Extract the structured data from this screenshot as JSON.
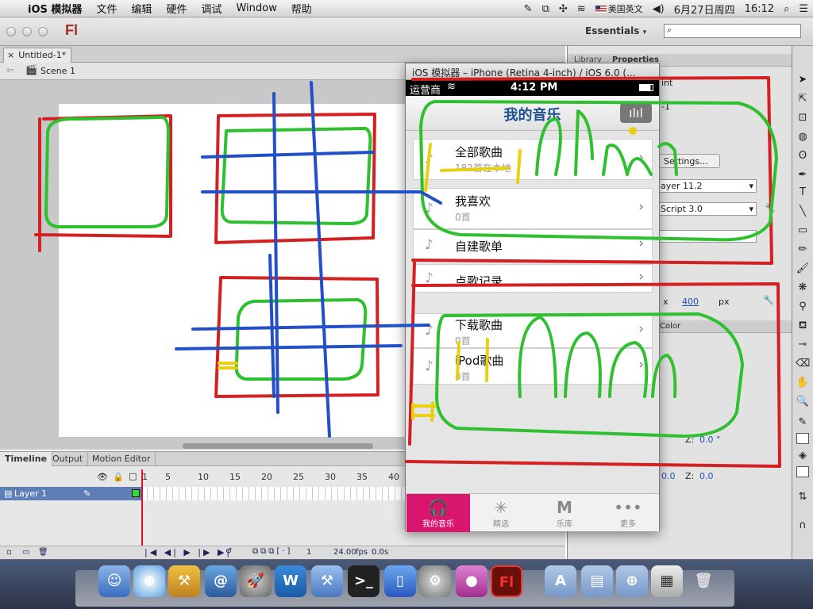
{
  "menubar": {
    "app": "iOS 模拟器",
    "items": [
      "文件",
      "编辑",
      "硬件",
      "调试",
      "Window",
      "帮助"
    ],
    "input_source": "美国英文",
    "date": "6月27日周四",
    "time": "16:12"
  },
  "flash": {
    "logo": "Fl",
    "workspace": "Essentials",
    "doc_tab": "Untitled-1*",
    "scene": "Scene 1",
    "timeline_tabs": [
      "Timeline",
      "Output",
      "Motion Editor"
    ],
    "layer_name": "Layer 1",
    "frame_numbers": [
      "1",
      "5",
      "10",
      "15",
      "20",
      "25",
      "30",
      "35",
      "40"
    ],
    "current_frame": "1",
    "fps": "24.00",
    "fps_unit": "fps",
    "time": "0.0",
    "time_unit": "s",
    "props": {
      "tabs": [
        "Library",
        "Properties"
      ],
      "partial_int": "int",
      "partial_1": "-1",
      "settings_btn": "Settings...",
      "player": "ayer 11.2",
      "script": "Script 3.0",
      "x_label": "x",
      "x_value": "400",
      "unit": "px",
      "color_tab": "Color",
      "z1_label": "Z:",
      "z1_value": "0.0 °",
      "y_value": "0.0",
      "z2_label": "Z:",
      "z2_value": "0.0"
    }
  },
  "simulator": {
    "window_title": "iOS 模拟器 – iPhone (Retina 4-inch) / iOS 6.0 (...",
    "carrier": "运营商",
    "clock": "4:12 PM",
    "nav_title": "我的音乐",
    "rows": [
      {
        "title": "全部歌曲",
        "subtitle": "182首在本地"
      },
      {
        "title": "我喜欢",
        "subtitle": "0首"
      },
      {
        "title": "自建歌单",
        "subtitle": ""
      },
      {
        "title": "点歌记录",
        "subtitle": ""
      },
      {
        "title": "下载歌曲",
        "subtitle": "0首"
      },
      {
        "title": "iPod歌曲",
        "subtitle": "0首"
      }
    ],
    "tabs": [
      "我的音乐",
      "精选",
      "乐库",
      "更多"
    ]
  },
  "colors": {
    "ink_red": "#d42020",
    "ink_green": "#2ec02e",
    "ink_blue": "#2350c8",
    "ink_yellow": "#e8d010",
    "tab_active": "#d8166e",
    "flash_red": "#a52e25"
  }
}
